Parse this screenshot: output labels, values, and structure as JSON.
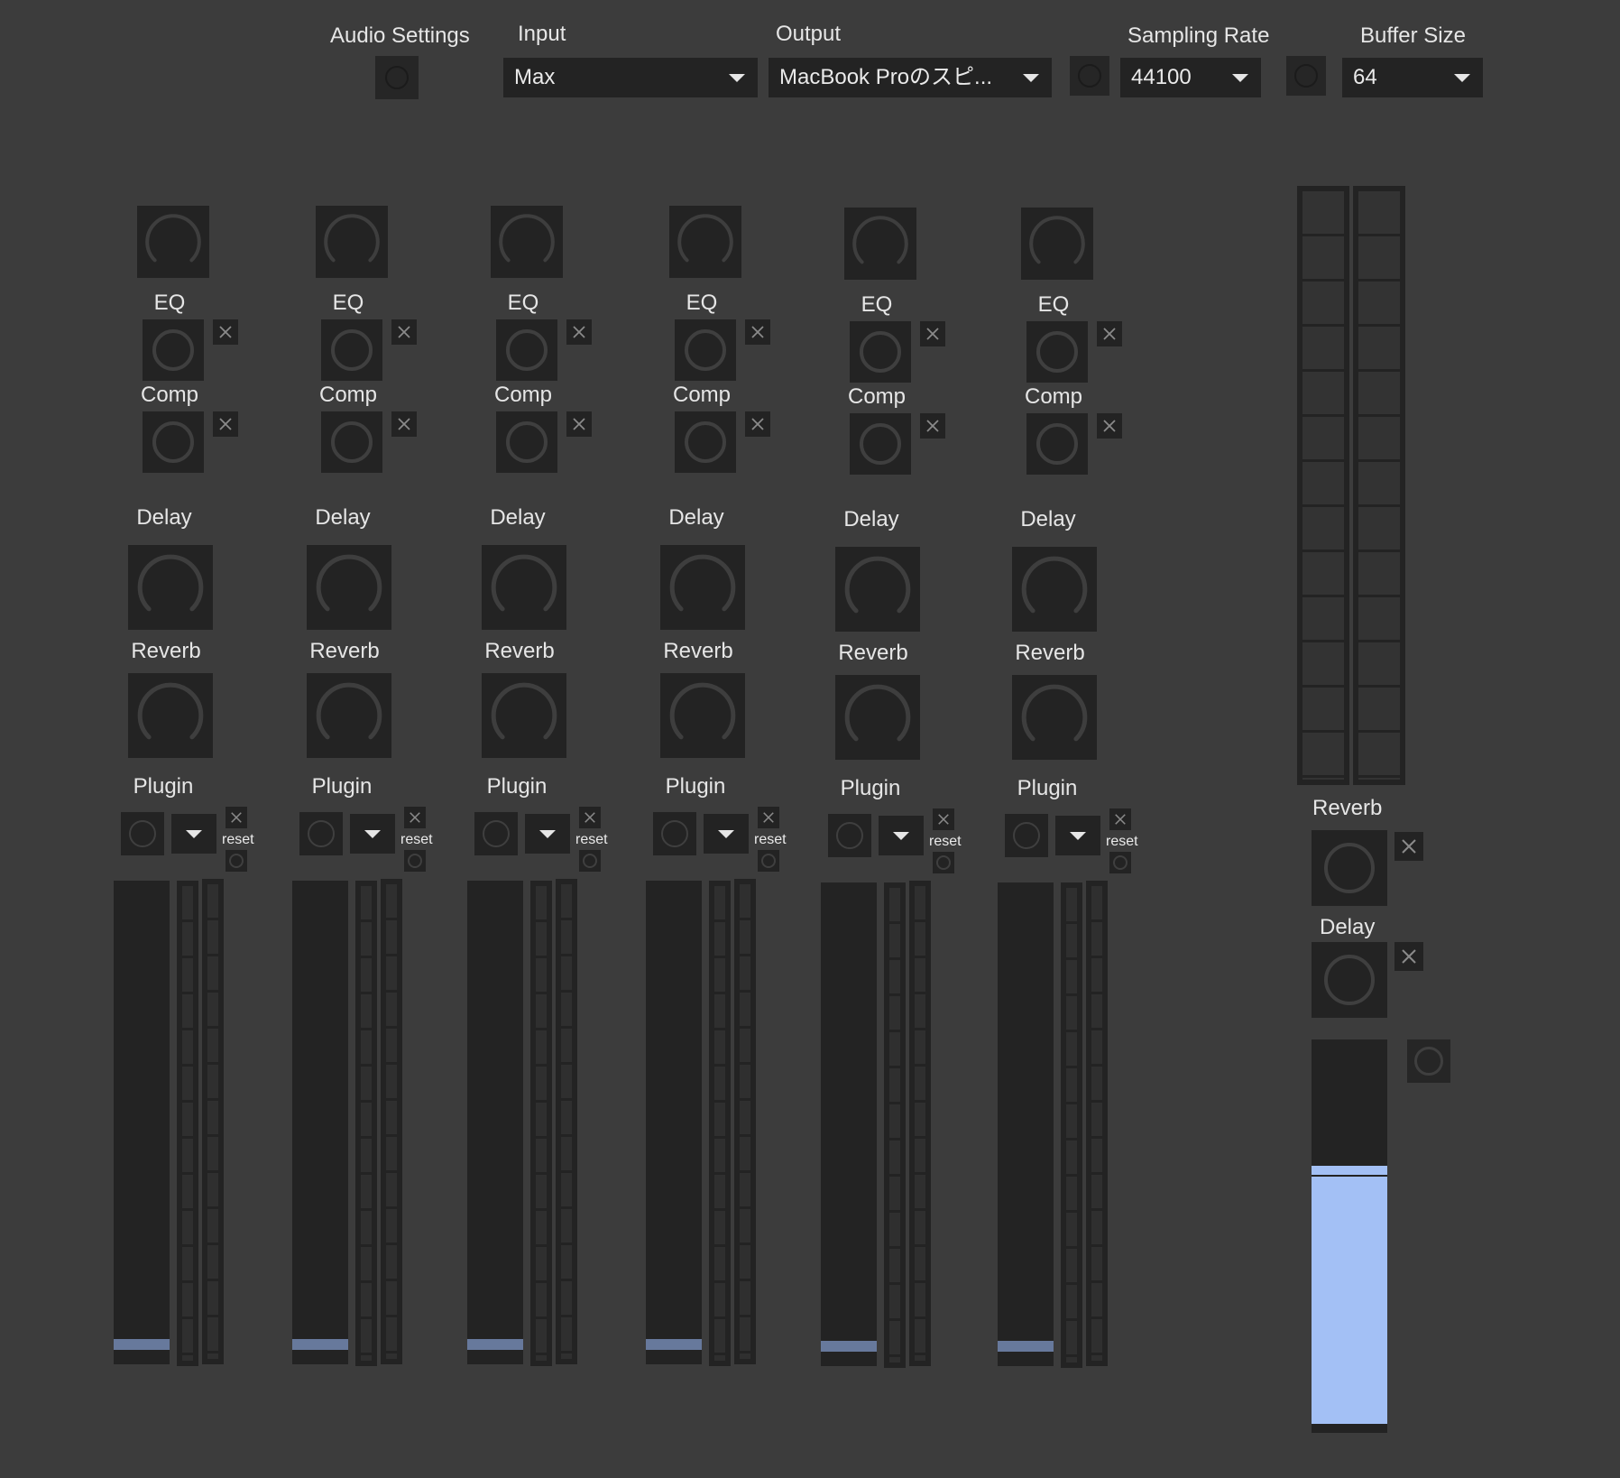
{
  "header": {
    "audio_settings_label": "Audio Settings",
    "input_label": "Input",
    "input_value": "Max",
    "output_label": "Output",
    "output_value": "MacBook Proのスピ...",
    "sampling_rate_label": "Sampling Rate",
    "sampling_rate_value": "44100",
    "buffer_size_label": "Buffer Size",
    "buffer_size_value": "64"
  },
  "channels": [
    {
      "eq": "EQ",
      "comp": "Comp",
      "delay": "Delay",
      "reverb": "Reverb",
      "plugin": "Plugin",
      "reset": "reset"
    },
    {
      "eq": "EQ",
      "comp": "Comp",
      "delay": "Delay",
      "reverb": "Reverb",
      "plugin": "Plugin",
      "reset": "reset"
    },
    {
      "eq": "EQ",
      "comp": "Comp",
      "delay": "Delay",
      "reverb": "Reverb",
      "plugin": "Plugin",
      "reset": "reset"
    },
    {
      "eq": "EQ",
      "comp": "Comp",
      "delay": "Delay",
      "reverb": "Reverb",
      "plugin": "Plugin",
      "reset": "reset"
    },
    {
      "eq": "EQ",
      "comp": "Comp",
      "delay": "Delay",
      "reverb": "Reverb",
      "plugin": "Plugin",
      "reset": "reset"
    },
    {
      "eq": "EQ",
      "comp": "Comp",
      "delay": "Delay",
      "reverb": "Reverb",
      "plugin": "Plugin",
      "reset": "reset"
    }
  ],
  "channel_fader_level": 0.03,
  "master": {
    "reverb_label": "Reverb",
    "delay_label": "Delay",
    "fader_level": 0.68
  },
  "colors": {
    "background": "#3c3c3c",
    "panel": "#232323",
    "fader_handle": "#67799c",
    "master_fill": "#a3c0f5"
  },
  "icons": {
    "toggle": "circle-icon",
    "close": "x-icon",
    "dropdown": "chevron-down-icon"
  }
}
